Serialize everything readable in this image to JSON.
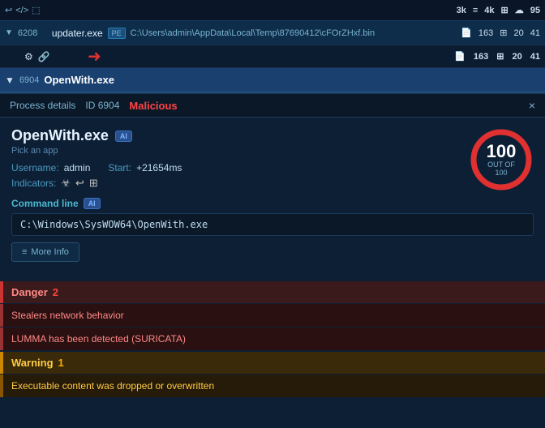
{
  "topbar": {
    "icons": [
      "↩",
      "</>",
      "⬚"
    ],
    "stats": {
      "count1": "3k",
      "icon1": "📋",
      "count2": "4k",
      "icon2": "⊞",
      "icon3": "☁",
      "count3": "95"
    }
  },
  "process_row1": {
    "pid": "6208",
    "name": "updater.exe",
    "badge": "PE",
    "filepath": "C:\\Users\\admin\\AppData\\Local\\Temp\\87690412\\cFOrZHxf.bin",
    "stats": {
      "count1": "163",
      "count2": "20",
      "count3": "41"
    }
  },
  "process_row2": {
    "pid": "6904",
    "name": "OpenWith.exe"
  },
  "details": {
    "tab_label": "Process details",
    "id_label": "ID 6904",
    "malicious_label": "Malicious",
    "close_label": "×"
  },
  "process_info": {
    "name": "OpenWith.exe",
    "ai_badge": "AI",
    "subtitle": "Pick an app",
    "username_label": "Username:",
    "username_value": "admin",
    "start_label": "Start:",
    "start_value": "+21654ms",
    "indicators_label": "Indicators:"
  },
  "score": {
    "value": "100",
    "out_of": "OUT OF 100"
  },
  "command_line": {
    "section_title": "Command line",
    "ai_badge": "AI",
    "value": "C:\\Windows\\SysWOW64\\OpenWith.exe"
  },
  "more_info_btn": "More Info",
  "danger": {
    "label": "Danger",
    "count": "2",
    "items": [
      "Stealers network behavior",
      "LUMMA has been detected (SURICATA)"
    ]
  },
  "warning": {
    "label": "Warning",
    "count": "1",
    "items": [
      "Executable content was dropped or overwritten"
    ]
  }
}
